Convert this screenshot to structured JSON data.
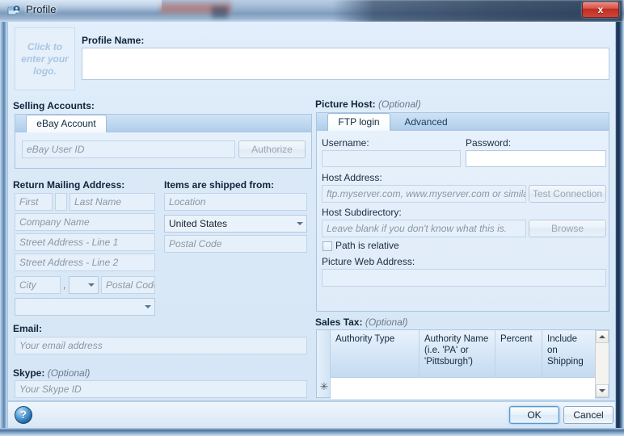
{
  "window": {
    "title": "Profile",
    "icon": "profile-icon",
    "close_label": "x"
  },
  "logo": {
    "placeholder_line1": "Click to",
    "placeholder_line2": "enter your",
    "placeholder_line3": "logo."
  },
  "profile_name": {
    "label": "Profile Name:",
    "value": "",
    "placeholder": ""
  },
  "selling_accounts": {
    "label": "Selling Accounts:",
    "tabs": [
      {
        "label": "eBay Account",
        "active": true
      }
    ],
    "user_id": {
      "placeholder": "eBay User ID",
      "value": ""
    },
    "authorize_button": "Authorize"
  },
  "return_mailing_address": {
    "label": "Return Mailing Address:",
    "first": {
      "placeholder": "First",
      "value": ""
    },
    "middle": {
      "placeholder": "",
      "value": ""
    },
    "last": {
      "placeholder": "Last Name",
      "value": ""
    },
    "company": {
      "placeholder": "Company Name",
      "value": ""
    },
    "street1": {
      "placeholder": "Street Address - Line 1",
      "value": ""
    },
    "street2": {
      "placeholder": "Street Address - Line 2",
      "value": ""
    },
    "city": {
      "placeholder": "City",
      "value": ""
    },
    "comma": ",",
    "state": {
      "value": "",
      "placeholder": ""
    },
    "postal": {
      "placeholder": "Postal Code",
      "value": ""
    },
    "extra_combo": {
      "value": "",
      "placeholder": ""
    }
  },
  "shipped_from": {
    "label": "Items are shipped from:",
    "location": {
      "placeholder": "Location",
      "value": ""
    },
    "country": {
      "value": "United States"
    },
    "postal": {
      "placeholder": "Postal Code",
      "value": ""
    }
  },
  "email": {
    "label": "Email:",
    "field": {
      "placeholder": "Your email address",
      "value": ""
    }
  },
  "skype": {
    "label": "Skype:",
    "optional": "(Optional)",
    "field": {
      "placeholder": "Your Skype ID",
      "value": ""
    }
  },
  "picture_host": {
    "label": "Picture Host:",
    "optional": "(Optional)",
    "tabs": [
      {
        "label": "FTP login",
        "active": true
      },
      {
        "label": "Advanced",
        "active": false
      }
    ],
    "username": {
      "label": "Username:",
      "value": "",
      "placeholder": ""
    },
    "password": {
      "label": "Password:",
      "value": "",
      "placeholder": ""
    },
    "host_address": {
      "label": "Host Address:",
      "placeholder": "ftp.myserver.com, www.myserver.com or similar",
      "value": ""
    },
    "test_connection_button": "Test Connection",
    "host_subdirectory": {
      "label": "Host Subdirectory:",
      "placeholder": "Leave blank if you don't know what this is.",
      "value": ""
    },
    "browse_button": "Browse",
    "path_is_relative": {
      "label": "Path is relative",
      "checked": false
    },
    "picture_web_address": {
      "label": "Picture Web Address:",
      "value": "",
      "placeholder": ""
    }
  },
  "sales_tax": {
    "label": "Sales Tax:",
    "optional": "(Optional)",
    "columns": [
      "Authority Type",
      "Authority Name (i.e. 'PA' or 'Pittsburgh')",
      "Percent",
      "Include on Shipping"
    ],
    "columns_display": {
      "authority_type": "Authority Type",
      "authority_name_l1": "Authority Name",
      "authority_name_l2": "(i.e. 'PA' or",
      "authority_name_l3": "'Pittsburgh')",
      "percent": "Percent",
      "include_l1": "Include",
      "include_l2": "on",
      "include_l3": "Shipping"
    },
    "rows": [],
    "new_row_marker": "✳"
  },
  "footer": {
    "help_glyph": "?",
    "ok_label": "OK",
    "cancel_label": "Cancel"
  }
}
